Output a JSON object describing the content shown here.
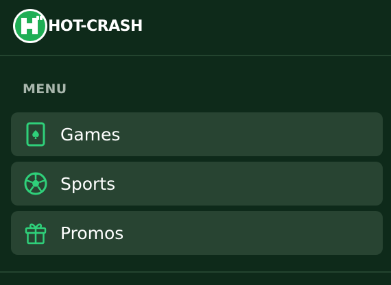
{
  "brand": {
    "name": "HOT-CRASH",
    "badge_glyph": "H",
    "accent_color": "#2fd07a"
  },
  "menu": {
    "heading": "MENU",
    "items": [
      {
        "label": "Games",
        "icon": "card-icon"
      },
      {
        "label": "Sports",
        "icon": "soccer-ball-icon"
      },
      {
        "label": "Promos",
        "icon": "gift-icon"
      }
    ]
  }
}
